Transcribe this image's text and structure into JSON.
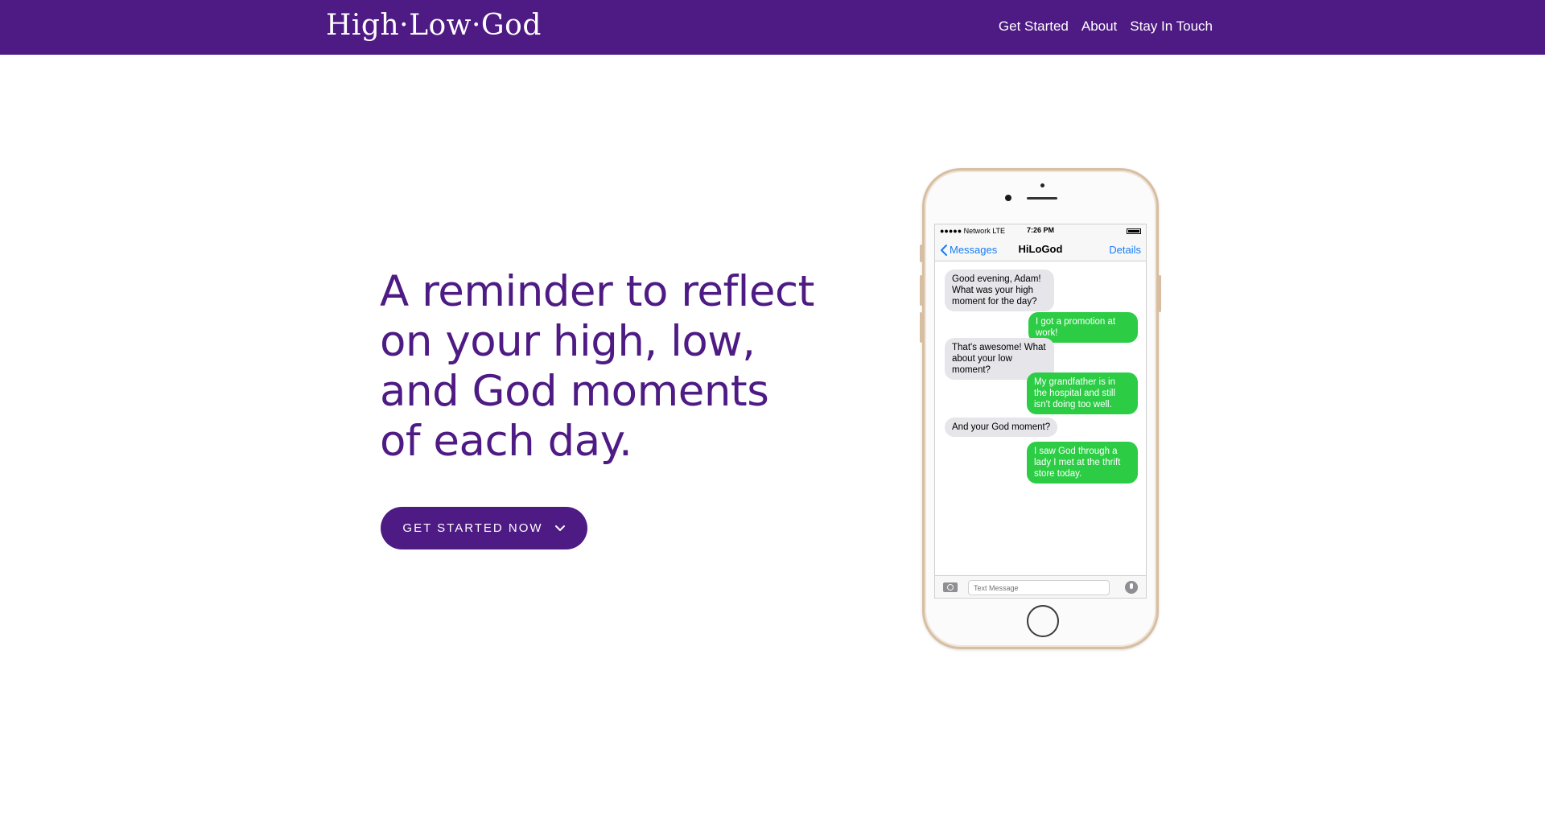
{
  "header": {
    "logo": "High·Low·God",
    "nav": [
      {
        "label": "Get Started"
      },
      {
        "label": "About"
      },
      {
        "label": "Stay In Touch"
      }
    ]
  },
  "hero": {
    "headline_lines": [
      "A reminder to reflect",
      "on your high, low,",
      "and God moments",
      "of each day."
    ],
    "cta_label": "GET STARTED NOW",
    "cta_icon": "chevron-down-icon"
  },
  "phone": {
    "status": {
      "carrier": "●●●●● Network  LTE",
      "time": "7:26 PM"
    },
    "header": {
      "back_label": "Messages",
      "contact": "HiLoGod",
      "details_label": "Details"
    },
    "messages": [
      {
        "from": "in",
        "text": "Good evening, Adam! What was your high moment for the day?"
      },
      {
        "from": "out",
        "text": "I got a promotion at work!"
      },
      {
        "from": "in",
        "text": "That's awesome! What about your low moment?"
      },
      {
        "from": "out",
        "text": "My grandfather is in the hospital and still isn't doing too well."
      },
      {
        "from": "in",
        "text": "And your God moment?"
      },
      {
        "from": "out",
        "text": "I saw God through a lady I met at the thrift store today."
      }
    ],
    "compose": {
      "placeholder": "Text Message"
    }
  },
  "colors": {
    "brand": "#4e1a84",
    "incoming": "#e5e5ea",
    "outgoing": "#2ccd45",
    "link": "#1a7cf6"
  }
}
